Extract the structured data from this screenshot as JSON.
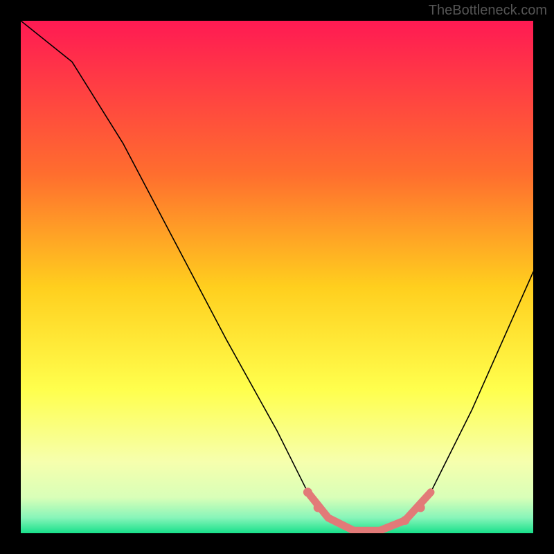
{
  "watermark": "TheBottleneck.com",
  "chart_data": {
    "type": "line",
    "title": "",
    "xlabel": "",
    "ylabel": "",
    "xlim": [
      0,
      100
    ],
    "ylim": [
      0,
      100
    ],
    "background_gradient": {
      "top": "#ff1a53",
      "mid1": "#ffb300",
      "mid2": "#ffff4d",
      "low": "#f7ffb3",
      "bottom": "#18e08a"
    },
    "series": [
      {
        "name": "main-curve",
        "color": "#000000",
        "stroke_width": 1.6,
        "points": [
          {
            "x": 0,
            "y": 100
          },
          {
            "x": 10,
            "y": 92
          },
          {
            "x": 20,
            "y": 76
          },
          {
            "x": 30,
            "y": 57
          },
          {
            "x": 40,
            "y": 38
          },
          {
            "x": 50,
            "y": 20
          },
          {
            "x": 56,
            "y": 8
          },
          {
            "x": 60,
            "y": 3
          },
          {
            "x": 65,
            "y": 0.5
          },
          {
            "x": 70,
            "y": 0.5
          },
          {
            "x": 75,
            "y": 2.5
          },
          {
            "x": 80,
            "y": 8
          },
          {
            "x": 88,
            "y": 24
          },
          {
            "x": 96,
            "y": 42
          },
          {
            "x": 100,
            "y": 51
          }
        ]
      },
      {
        "name": "highlight-segment",
        "color": "#e27a78",
        "stroke_width": 11,
        "points": [
          {
            "x": 56,
            "y": 8
          },
          {
            "x": 60,
            "y": 3
          },
          {
            "x": 65,
            "y": 0.5
          },
          {
            "x": 70,
            "y": 0.5
          },
          {
            "x": 75,
            "y": 2.5
          },
          {
            "x": 80,
            "y": 8
          }
        ]
      }
    ],
    "markers": [
      {
        "x": 56,
        "y": 8,
        "r": 6.5,
        "color": "#e27a78"
      },
      {
        "x": 58,
        "y": 5,
        "r": 6.5,
        "color": "#e27a78"
      },
      {
        "x": 75,
        "y": 2.5,
        "r": 6.5,
        "color": "#e27a78"
      },
      {
        "x": 78,
        "y": 5,
        "r": 6.5,
        "color": "#e27a78"
      }
    ]
  }
}
